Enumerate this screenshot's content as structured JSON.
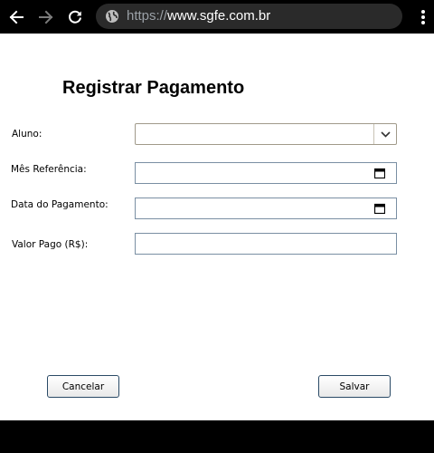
{
  "browser": {
    "url_scheme": "https://",
    "url_host": "www.sgfe.com.br"
  },
  "form": {
    "title": "Registrar Pagamento",
    "fields": {
      "aluno": {
        "label": "Aluno:",
        "value": ""
      },
      "mes_referencia": {
        "label": "Mês Referência:",
        "value": ""
      },
      "data_pagamento": {
        "label": "Data do Pagamento:",
        "value": ""
      },
      "valor_pago": {
        "label": "Valor Pago (R$):",
        "value": ""
      }
    },
    "buttons": {
      "cancel": "Cancelar",
      "save": "Salvar"
    }
  },
  "colors": {
    "toolbar_bg": "#000000",
    "urlbar_bg": "#2a2a2a",
    "field_border": "#7a8fa3",
    "button_border": "#2a4a66"
  },
  "icons": {
    "back": "arrow-left-icon",
    "forward": "arrow-right-icon",
    "reload": "reload-icon",
    "site_info": "globe-icon",
    "menu": "kebab-menu-icon",
    "dropdown": "chevron-down-icon",
    "calendar": "calendar-icon"
  }
}
